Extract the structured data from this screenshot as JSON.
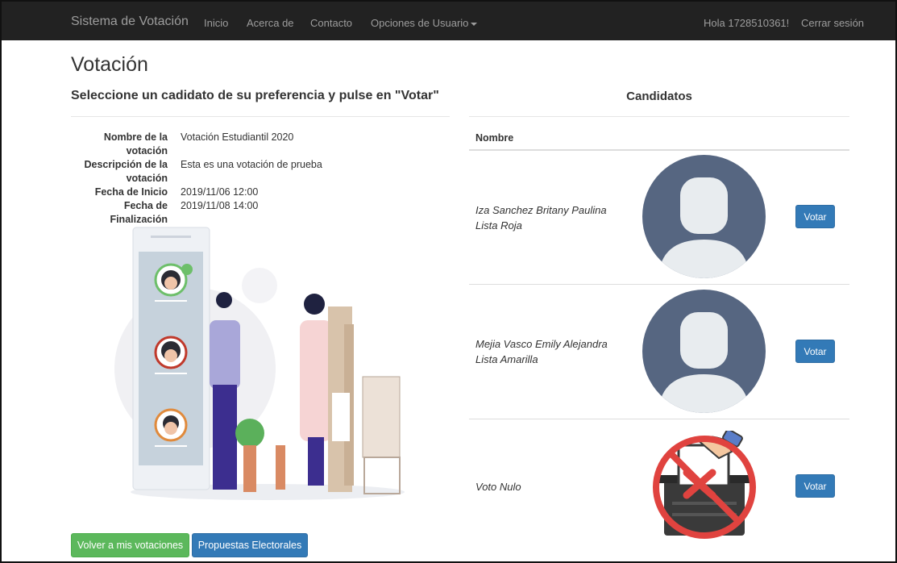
{
  "navbar": {
    "brand": "Sistema de Votación",
    "links": [
      "Inicio",
      "Acerca de",
      "Contacto",
      "Opciones de Usuario"
    ],
    "greeting": "Hola 1728510361!",
    "logout": "Cerrar sesión"
  },
  "page": {
    "title": "Votación",
    "subtitle": "Seleccione un cadidato de su preferencia y pulse en \"Votar\""
  },
  "details": {
    "name_label": "Nombre de la votación",
    "name_value": "Votación Estudiantil 2020",
    "desc_label": "Descripción de la votación",
    "desc_value": "Esta es una votación de prueba",
    "start_label": "Fecha de Inicio",
    "start_value": "2019/11/06 12:00",
    "end_label": "Fecha de Finalización",
    "end_value": "2019/11/08 14:00"
  },
  "buttons": {
    "back": "Volver a mis votaciones",
    "proposals": "Propuestas Electorales"
  },
  "candidates": {
    "title": "Candidatos",
    "column_name": "Nombre",
    "vote_label": "Votar",
    "items": [
      {
        "name": "Iza Sanchez Britany Paulina",
        "list": "Lista Roja"
      },
      {
        "name": "Mejia Vasco Emily Alejandra",
        "list": "Lista Amarilla"
      },
      {
        "name": "Voto Nulo",
        "list": ""
      }
    ]
  },
  "colors": {
    "navbar": "#222222",
    "primary": "#337ab7",
    "success": "#5cb85c",
    "avatar_bg": "#566681",
    "avatar_fg": "#e8ecef",
    "null_red": "#e0433f"
  }
}
